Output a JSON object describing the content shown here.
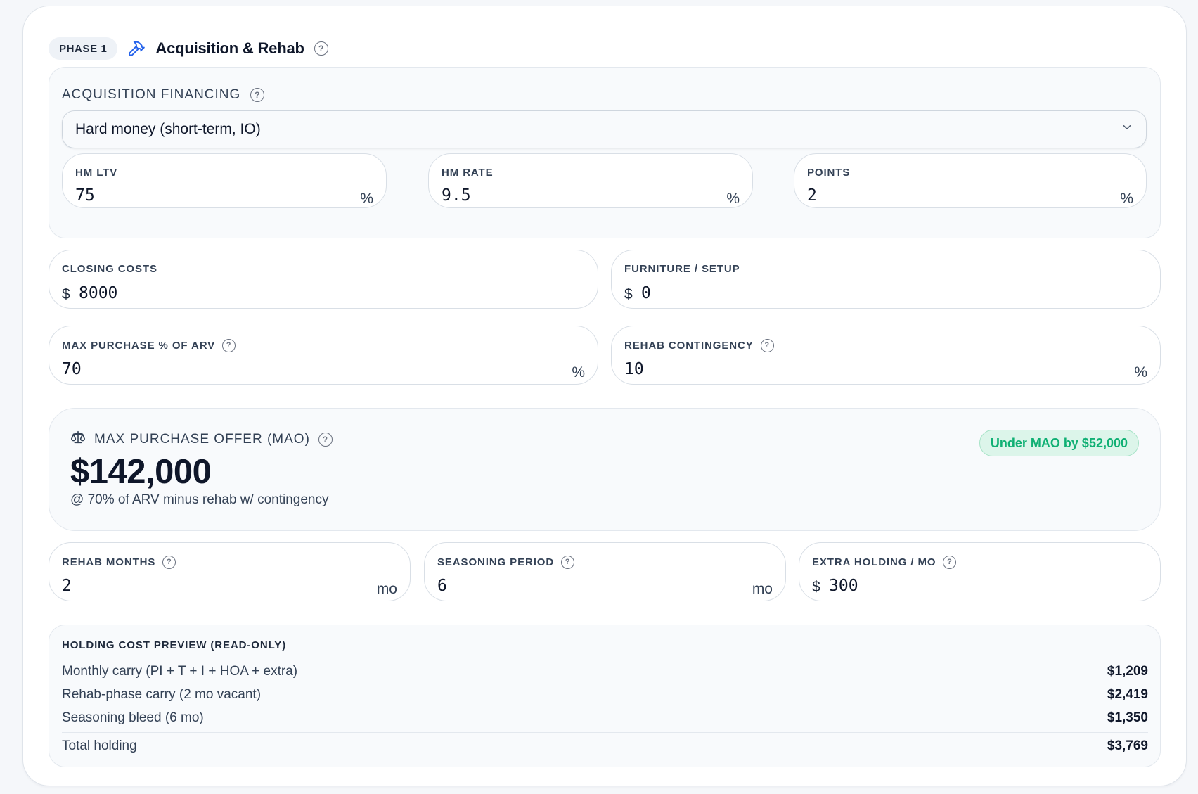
{
  "header": {
    "phase": "PHASE 1",
    "title": "Acquisition & Rehab"
  },
  "acquisition": {
    "label": "ACQUISITION FINANCING",
    "financing_type": "Hard money (short-term, IO)",
    "fields": {
      "hm_ltv": {
        "label": "HM LTV",
        "value": "75",
        "suffix": "%"
      },
      "hm_rate": {
        "label": "HM RATE",
        "value": "9.5",
        "suffix": "%"
      },
      "points": {
        "label": "POINTS",
        "value": "2",
        "suffix": "%"
      }
    }
  },
  "costs": {
    "closing_costs": {
      "label": "CLOSING COSTS",
      "prefix": "$",
      "value": "8000"
    },
    "furniture_setup": {
      "label": "FURNITURE / SETUP",
      "prefix": "$",
      "value": "0"
    },
    "max_purchase_pct": {
      "label": "MAX PURCHASE % OF ARV",
      "value": "70",
      "suffix": "%"
    },
    "rehab_contingency": {
      "label": "REHAB CONTINGENCY",
      "value": "10",
      "suffix": "%"
    }
  },
  "mao": {
    "label": "MAX PURCHASE OFFER (MAO)",
    "value": "$142,000",
    "note": "@ 70% of ARV minus rehab w/ contingency",
    "badge": "Under MAO by $52,000",
    "badge_color": "#10b074"
  },
  "timing": {
    "rehab_months": {
      "label": "REHAB MONTHS",
      "value": "2",
      "suffix": "mo"
    },
    "seasoning_period": {
      "label": "SEASONING PERIOD",
      "value": "6",
      "suffix": "mo"
    },
    "extra_holding": {
      "label": "EXTRA HOLDING / MO",
      "prefix": "$",
      "value": "300"
    }
  },
  "holding": {
    "title": "HOLDING COST PREVIEW (READ-ONLY)",
    "rows": [
      {
        "label": "Monthly carry (PI + T + I + HOA + extra)",
        "amount": "$1,209"
      },
      {
        "label": "Rehab-phase carry (2 mo vacant)",
        "amount": "$2,419"
      },
      {
        "label": "Seasoning bleed (6 mo)",
        "amount": "$1,350"
      }
    ],
    "total": {
      "label": "Total holding",
      "amount": "$3,769"
    }
  },
  "icons": {
    "phase": "hammer-icon",
    "help": "help-circle-icon",
    "dropdown": "chevron-down-icon",
    "mao": "scale-icon"
  },
  "colors": {
    "accent": "#2563eb",
    "success": "#10b074"
  }
}
